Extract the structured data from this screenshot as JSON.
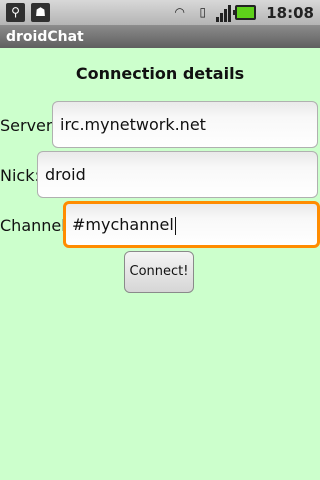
{
  "status_bar": {
    "icons": [
      "usb-icon",
      "android-debug-icon",
      "wifi-icon",
      "sim-card-icon",
      "signal-icon",
      "battery-icon"
    ],
    "time": "18:08"
  },
  "app": {
    "title": "droidChat"
  },
  "form": {
    "heading": "Connection details",
    "server": {
      "label": "Server:",
      "value": "irc.mynetwork.net"
    },
    "nick": {
      "label": "Nick:",
      "value": "droid"
    },
    "channel": {
      "label": "Channel:",
      "value": "#mychannel"
    },
    "connect_label": "Connect!"
  },
  "colors": {
    "background": "#ccffcc",
    "focus_border": "#ff8c00",
    "title_bar": "#6e6e6e"
  }
}
